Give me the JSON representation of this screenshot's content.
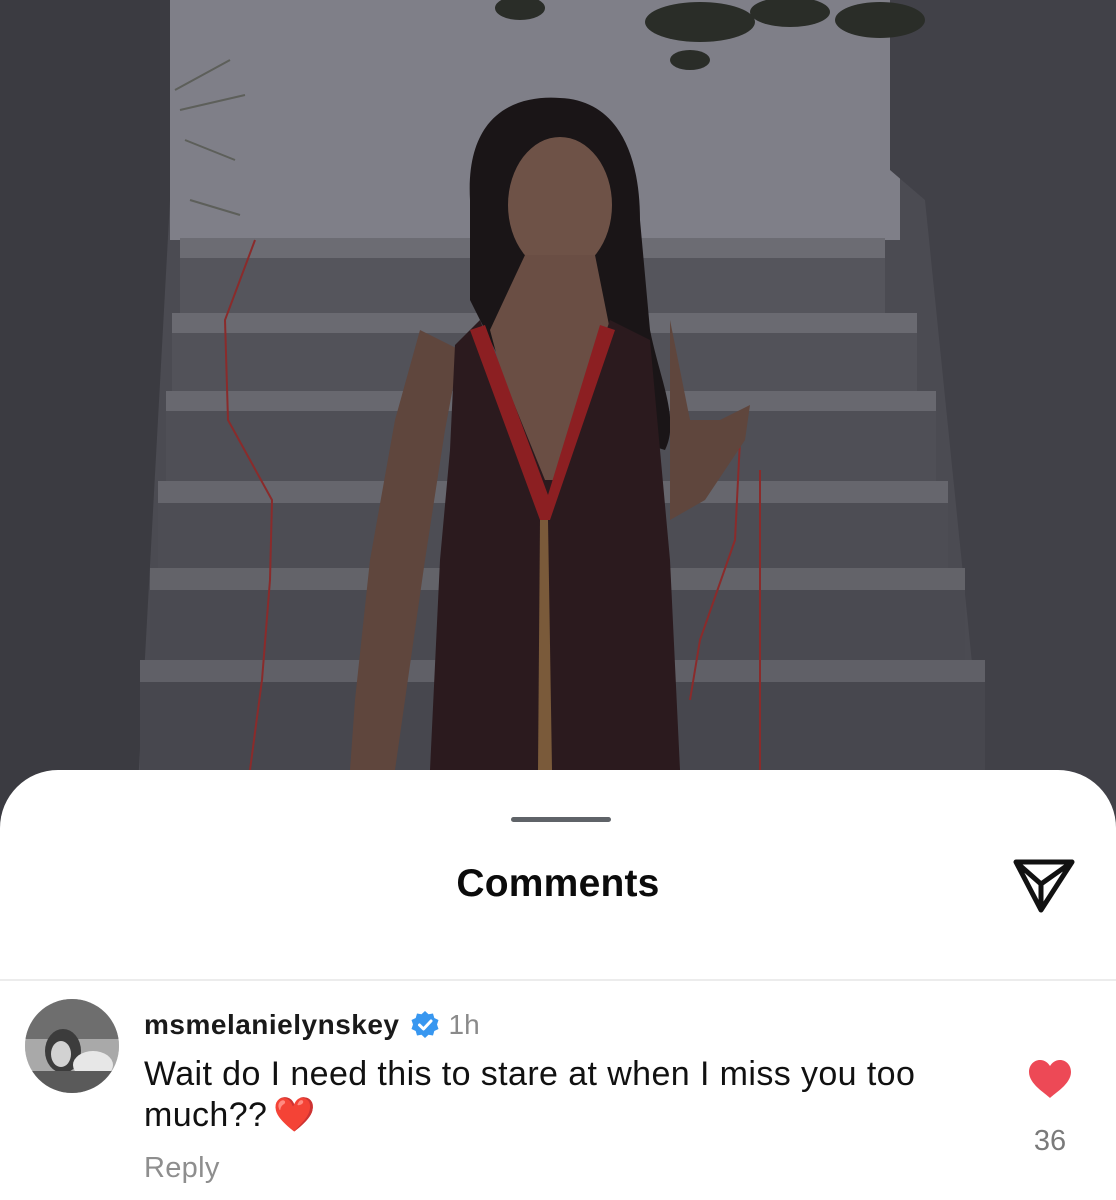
{
  "photo": {
    "alt_icon": "post-photo"
  },
  "sheet": {
    "title": "Comments"
  },
  "comment": {
    "username": "msmelanielynskey",
    "timestamp": "1h",
    "text": "Wait do I need this to stare at when I miss you too much??",
    "emoji": "❤️",
    "reply_label": "Reply",
    "like_count": "36"
  },
  "colors": {
    "like": "#ed4956",
    "verified": "#3897f0"
  }
}
